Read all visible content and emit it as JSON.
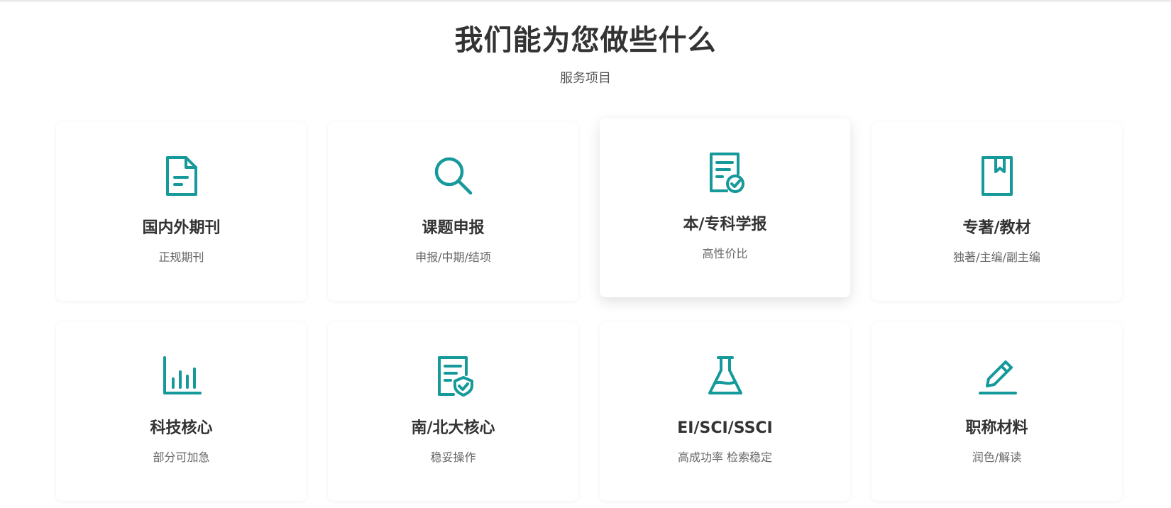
{
  "section": {
    "title": "我们能为您做些什么",
    "subtitle": "服务项目"
  },
  "theme": {
    "accent": "#16999b",
    "title_color": "#333333",
    "text_color": "#666666"
  },
  "services": [
    {
      "title": "国内外期刊",
      "desc": "正规期刊",
      "icon": "document-icon"
    },
    {
      "title": "课题申报",
      "desc": "申报/中期/结项",
      "icon": "search-icon"
    },
    {
      "title": "本/专科学报",
      "desc": "高性价比",
      "icon": "certificate-check-icon"
    },
    {
      "title": "专著/教材",
      "desc": "独著/主编/副主编",
      "icon": "book-icon"
    },
    {
      "title": "科技核心",
      "desc": "部分可加急",
      "icon": "bar-chart-icon"
    },
    {
      "title": "南/北大核心",
      "desc": "稳妥操作",
      "icon": "document-shield-icon"
    },
    {
      "title": "EI/SCI/SSCI",
      "desc": "高成功率 检索稳定",
      "icon": "flask-icon"
    },
    {
      "title": "职称材料",
      "desc": "润色/解读",
      "icon": "pencil-icon"
    }
  ]
}
